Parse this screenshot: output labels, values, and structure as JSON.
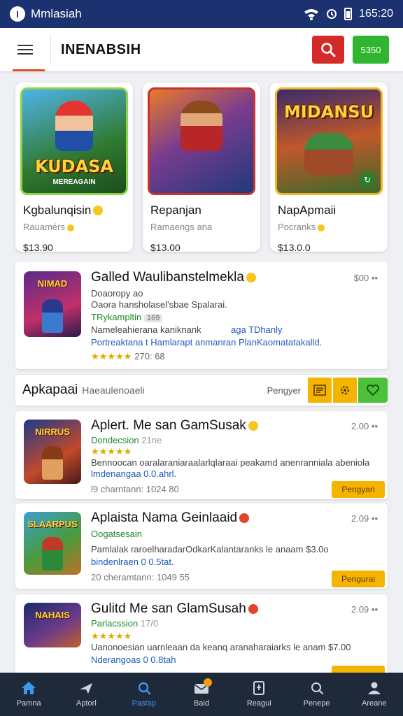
{
  "status_bar": {
    "app_name": "Mmlasiah",
    "time": "165:20"
  },
  "header": {
    "title": "INENABSIH",
    "green_button_label": "5350"
  },
  "featured": [
    {
      "art_title": "KUDASA",
      "art_subtitle": "MEREAGAIN",
      "name": "Kgbalunqisin",
      "subtitle": "Rauamérs",
      "price": "$13.90"
    },
    {
      "art_title": "",
      "art_subtitle": "",
      "name": "Repanjan",
      "subtitle": "Ramaengs ana",
      "price": "$13.00"
    },
    {
      "art_title": "MIDANSU",
      "art_subtitle": "",
      "name": "NapApmaii",
      "subtitle": "Pocranks",
      "price": "$13.0.0"
    }
  ],
  "top_item": {
    "thumb_title": "NIMAD",
    "title": "Galled Waulibanstelmekla",
    "price": "$00",
    "line1": "Doaoropy ao",
    "line2": "Oaora hansholasel'sbae Spalarai.",
    "line3": "TRykampltin",
    "line3_badge": "169",
    "line4_left": "Nameleahierana kaniknank",
    "line4_right": "aga TDhanly",
    "line5": "Portreaktana t Hamlarapt anmanran PlanKaomatatakalld.",
    "rating_count": "270: 68"
  },
  "section": {
    "title": "Apkapaai",
    "subtitle": "Haeaulenoaeli",
    "sort_label": "Pengyer"
  },
  "items": [
    {
      "thumb_title": "NIRRUS",
      "title": "Aplert. Me san GamSusak",
      "price": "2.00",
      "developer": "Dondecsion",
      "developer_extra": "21ne",
      "desc": "Bennoocan oaralaraniaraalarlqlaraai peakamd anenranniala abeniola",
      "meta1": "lmdenangaa 0.0.ahrl.",
      "meta2": "l9 charntann: 1024 80",
      "pill": "Pengyari"
    },
    {
      "thumb_title": "SLAARPUS",
      "title": "Aplaista Nama Geinlaaid",
      "price": "2.09",
      "developer": "Oogatsesain",
      "developer_extra": "",
      "desc": "Pamlalak raroelharadarOdkarKalantaranks le anaam $3.0o",
      "meta1": "bindenlraen 0 0.5tat.",
      "meta2": "20 cheramtann: 1049 55",
      "pill": "Pengurai"
    },
    {
      "thumb_title": "NAHAIS",
      "title": "Gulitd Me san GlamSusah",
      "price": "2.09",
      "developer": "Parlacssion",
      "developer_extra": "17/0",
      "desc": "Uanonoesian uarnleaan da keanq aranaharaiarks le anam $7.00",
      "meta1": "Nderangoas 0 0.8tah",
      "meta2": "",
      "pill": ""
    }
  ],
  "bottom_nav": [
    "Pamna",
    "Aptorl",
    "Pastap",
    "Baid",
    "Reagui",
    "Penepe",
    "Areane"
  ],
  "colors": {
    "status_bar": "#1c3270",
    "accent_red": "#d52a2a",
    "accent_green": "#2fb52f",
    "nav_bg": "#1e2a3a",
    "nav_active": "#3d97f0"
  }
}
